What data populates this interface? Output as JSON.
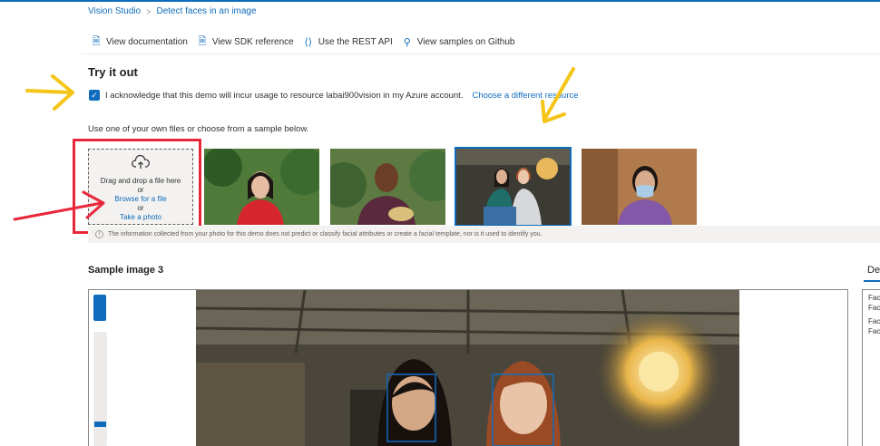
{
  "breadcrumb": {
    "root": "Vision Studio",
    "separator": ">",
    "current": "Detect faces in an image"
  },
  "links": [
    {
      "icon": "document-icon",
      "label": "View documentation"
    },
    {
      "icon": "document-icon",
      "label": "View SDK reference"
    },
    {
      "icon": "code-braces-icon",
      "label": "Use the REST API"
    },
    {
      "icon": "github-samples-icon",
      "label": "View samples on Github"
    }
  ],
  "try_it": {
    "title": "Try it out",
    "ack_checked": true,
    "ack_text": "I acknowledge that this demo will incur usage to resource labai900vision in my Azure account.",
    "change_resource": "Choose a different resource"
  },
  "hint": "Use one of your own files or choose from a sample below.",
  "dropzone": {
    "line1": "Drag and drop a file here",
    "or1": "or",
    "browse": "Browse for a file",
    "or2": "or",
    "take_photo": "Take a photo"
  },
  "samples": [
    {
      "name": "sample-1"
    },
    {
      "name": "sample-2"
    },
    {
      "name": "sample-3",
      "selected": true
    },
    {
      "name": "sample-4"
    }
  ],
  "info_text": "The information collected from your photo for this demo does not predict or classify facial attributes or create a facial template, nor is it used to identify you.",
  "section": {
    "title": "Sample image 3",
    "right_tab": "De"
  },
  "panel": {
    "lines": [
      "Fac",
      "Fac",
      "Fac",
      "Fac"
    ]
  },
  "colors": {
    "accent": "#0f6cbd",
    "annotation_red": "#e8283a",
    "annotation_yellow": "#f5c518"
  }
}
